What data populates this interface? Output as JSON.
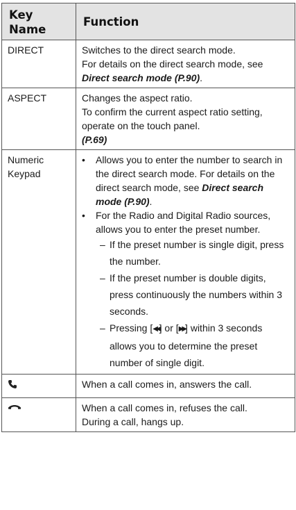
{
  "header": {
    "key_name": "Key Name",
    "function": "Function"
  },
  "rows": [
    {
      "key": "DIRECT",
      "lines": [
        "Switches to the direct search mode.",
        "For details on the direct search mode, see "
      ],
      "ref": "Direct search mode (P.90)",
      "tail": "."
    },
    {
      "key": "ASPECT",
      "lines": [
        "Changes the aspect ratio.",
        "To confirm the current aspect ratio setting, operate on the touch panel."
      ],
      "ref": "(P.69)"
    },
    {
      "key": "Numeric Keypad",
      "bullets": [
        {
          "text": "Allows you to enter the number to search in the direct search mode. For details on the direct search mode, see ",
          "ref": "Direct search mode (P.90)",
          "tail": "."
        },
        {
          "text": "For the Radio and Digital Radio sources, allows you to enter the preset number.",
          "subitems": [
            "If the preset number is single digit, press the number.",
            "If the preset number is double digits, press continuously the numbers within 3 seconds.",
            "within 3 seconds allows you to determine the preset number of single digit."
          ],
          "press_prefix": "Pressing [",
          "prev_glyph": "◀◀",
          "press_mid": "] or [",
          "next_glyph": "▶▶",
          "press_close": "] "
        }
      ]
    },
    {
      "key_icon": "phone-answer-icon",
      "text": "When a call comes in, answers the call."
    },
    {
      "key_icon": "phone-hangup-icon",
      "lines": [
        "When a call comes in, refuses the call.",
        "During a call, hangs up."
      ]
    }
  ],
  "colors": {
    "header_bg": "#e3e3e3",
    "border": "#555555",
    "text": "#1a1a1a"
  }
}
